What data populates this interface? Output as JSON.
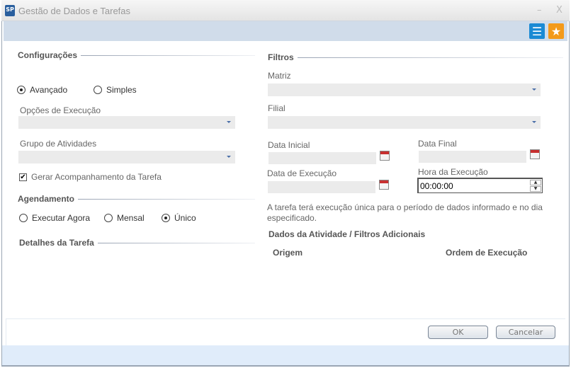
{
  "window": {
    "title": "Gestão de Dados e Tarefas",
    "logo": "SP",
    "minimize": "–",
    "close": "X"
  },
  "toolbar": {
    "icons": [
      "list-icon",
      "star-icon"
    ],
    "list_color": "#1a8ad4",
    "star_color": "#f39a1a"
  },
  "config": {
    "heading": "Configurações",
    "mode_options": [
      {
        "label": "Avançado",
        "selected": true
      },
      {
        "label": "Simples",
        "selected": false
      }
    ],
    "exec_options_label": "Opções de Execução",
    "exec_options_value": "",
    "group_label": "Grupo de Atividades",
    "group_value": "",
    "tracking_label": "Gerar Acompanhamento da Tarefa",
    "tracking_checked": true
  },
  "schedule": {
    "heading": "Agendamento",
    "options": [
      {
        "label": "Executar Agora",
        "selected": false
      },
      {
        "label": "Mensal",
        "selected": false
      },
      {
        "label": "Único",
        "selected": true
      }
    ]
  },
  "details": {
    "heading": "Detalhes da Tarefa"
  },
  "filters": {
    "heading": "Filtros",
    "matriz_label": "Matriz",
    "filial_label": "Filial",
    "start_date_label": "Data Inicial",
    "end_date_label": "Data Final",
    "exec_date_label": "Data de Execução",
    "exec_time_label": "Hora da Execução",
    "exec_time_value": "00:00:00",
    "info": "A tarefa terá execução única para o período de dados informado e no dia especificado."
  },
  "activity": {
    "heading": "Dados da Atividade / Filtros Adicionais",
    "columns": [
      "Origem",
      "Ordem de Execução"
    ]
  },
  "footer": {
    "ok": "OK",
    "cancel": "Cancelar"
  }
}
